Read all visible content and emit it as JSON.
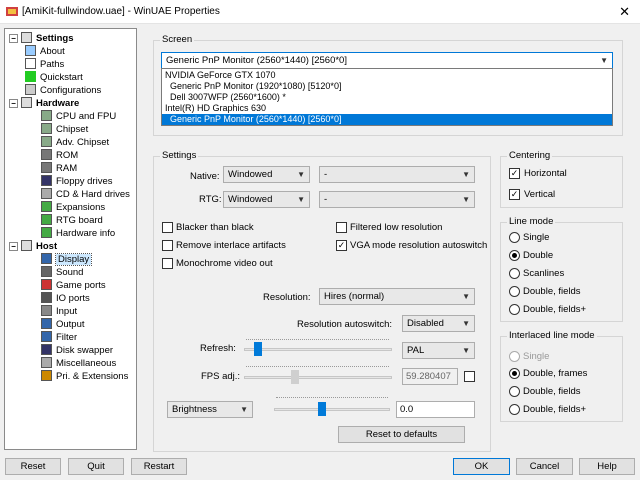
{
  "window": {
    "title": "[AmiKit-fullwindow.uae] - WinUAE Properties",
    "close_glyph": "✕"
  },
  "tree": {
    "settings": "Settings",
    "items_settings": [
      "About",
      "Paths",
      "Quickstart",
      "Configurations"
    ],
    "hardware": "Hardware",
    "items_hardware": [
      "CPU and FPU",
      "Chipset",
      "Adv. Chipset",
      "ROM",
      "RAM",
      "Floppy drives",
      "CD & Hard drives",
      "Expansions",
      "RTG board",
      "Hardware info"
    ],
    "host": "Host",
    "items_host": [
      "Display",
      "Sound",
      "Game ports",
      "IO ports",
      "Input",
      "Output",
      "Filter",
      "Disk swapper",
      "Miscellaneous",
      "Pri. & Extensions"
    ]
  },
  "screen": {
    "group_title": "Screen",
    "selected_monitor": "Generic PnP Monitor (2560*1440) [2560*0]",
    "dropdown_items": [
      "NVIDIA GeForce GTX 1070",
      "Generic PnP Monitor (1920*1080) [5120*0]",
      "Dell 3007WFP (2560*1600) *",
      "Intel(R) HD Graphics 630",
      "Generic PnP Monitor (2560*1440) [2560*0]"
    ]
  },
  "settings": {
    "group_title": "Settings",
    "native_label": "Native:",
    "native_mode": "Windowed",
    "native_res": "-",
    "rtg_label": "RTG:",
    "rtg_mode": "Windowed",
    "rtg_res": "-",
    "chk_blacker": "Blacker than black",
    "chk_remove_interlace": "Remove interlace artifacts",
    "chk_monochrome": "Monochrome video out",
    "chk_filtered": "Filtered low resolution",
    "chk_vga": "VGA mode resolution autoswitch",
    "resolution_label": "Resolution:",
    "resolution_value": "Hires (normal)",
    "autoswitch_label": "Resolution autoswitch:",
    "autoswitch_value": "Disabled",
    "refresh_label": "Refresh:",
    "refresh_mode": "PAL",
    "fps_label": "FPS adj.:",
    "fps_value": "59.280407",
    "brightness_select": "Brightness",
    "brightness_value": "0.0",
    "reset_defaults": "Reset to defaults"
  },
  "centering": {
    "group_title": "Centering",
    "horizontal": "Horizontal",
    "vertical": "Vertical"
  },
  "line_mode": {
    "group_title": "Line mode",
    "options": [
      "Single",
      "Double",
      "Scanlines",
      "Double, fields",
      "Double, fields+"
    ],
    "selected": 1
  },
  "interlaced": {
    "group_title": "Interlaced line mode",
    "options": [
      "Single",
      "Double, frames",
      "Double, fields",
      "Double, fields+"
    ],
    "selected": 1
  },
  "footer": {
    "reset": "Reset",
    "quit": "Quit",
    "restart": "Restart",
    "ok": "OK",
    "cancel": "Cancel",
    "help": "Help"
  },
  "colors": {
    "selection_blue": "#0078d7",
    "slider_blue": "#007ad9"
  }
}
